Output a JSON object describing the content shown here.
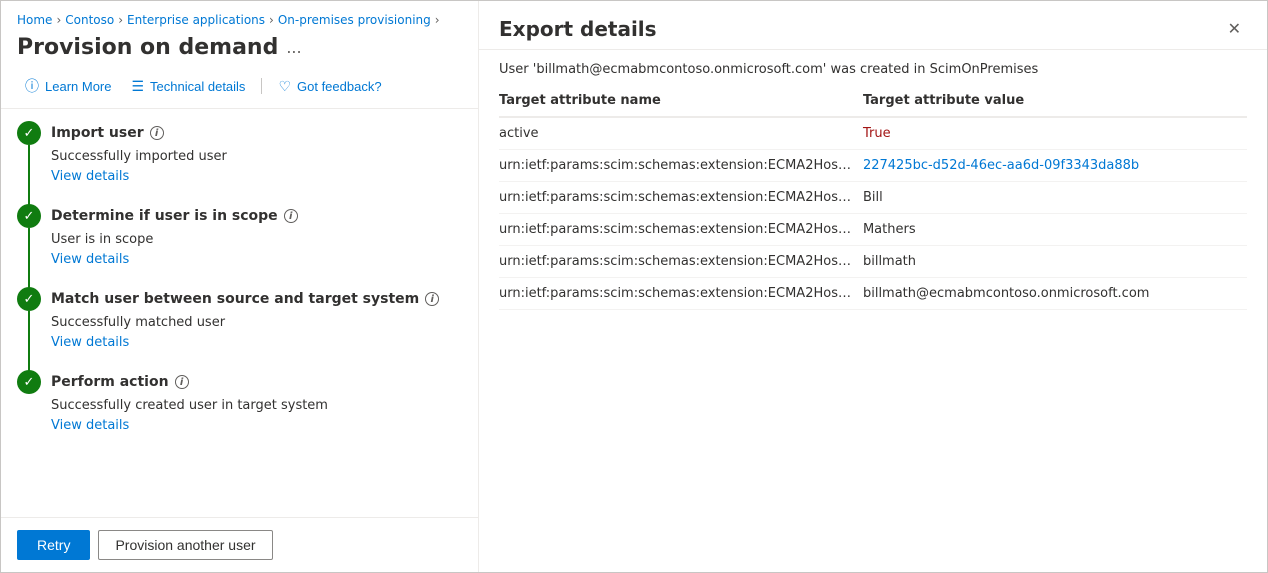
{
  "breadcrumb": {
    "items": [
      {
        "label": "Home",
        "link": true
      },
      {
        "label": "Contoso",
        "link": true
      },
      {
        "label": "Enterprise applications",
        "link": true
      },
      {
        "label": "On-premises provisioning",
        "link": true
      }
    ]
  },
  "left": {
    "title": "Provision on demand",
    "more_label": "...",
    "toolbar": {
      "learn_more": "Learn More",
      "technical_details": "Technical details",
      "got_feedback": "Got feedback?"
    },
    "steps": [
      {
        "title": "Import user",
        "desc": "Successfully imported user",
        "link_label": "View details"
      },
      {
        "title": "Determine if user is in scope",
        "desc": "User is in scope",
        "link_label": "View details"
      },
      {
        "title": "Match user between source and target system",
        "desc": "Successfully matched user",
        "link_label": "View details"
      },
      {
        "title": "Perform action",
        "desc": "Successfully created user in target system",
        "link_label": "View details"
      }
    ],
    "footer": {
      "retry_label": "Retry",
      "provision_another_label": "Provision another user"
    }
  },
  "right": {
    "title": "Export details",
    "close_label": "✕",
    "message": "User 'billmath@ecmabmcontoso.onmicrosoft.com' was created in ScimOnPremises",
    "table": {
      "col_attr": "Target attribute name",
      "col_val": "Target attribute value",
      "rows": [
        {
          "attr": "active",
          "val": "True",
          "val_type": "red"
        },
        {
          "attr": "urn:ietf:params:scim:schemas:extension:ECMA2Hos…",
          "val": "227425bc-d52d-46ec-aa6d-09f3343da88b",
          "val_type": "blue"
        },
        {
          "attr": "urn:ietf:params:scim:schemas:extension:ECMA2Hos…",
          "val": "Bill",
          "val_type": "plain"
        },
        {
          "attr": "urn:ietf:params:scim:schemas:extension:ECMA2Hos…",
          "val": "Mathers",
          "val_type": "plain"
        },
        {
          "attr": "urn:ietf:params:scim:schemas:extension:ECMA2Hos…",
          "val": "billmath",
          "val_type": "plain"
        },
        {
          "attr": "urn:ietf:params:scim:schemas:extension:ECMA2Hos…",
          "val": "billmath@ecmabmcontoso.onmicrosoft.com",
          "val_type": "plain"
        }
      ]
    }
  }
}
